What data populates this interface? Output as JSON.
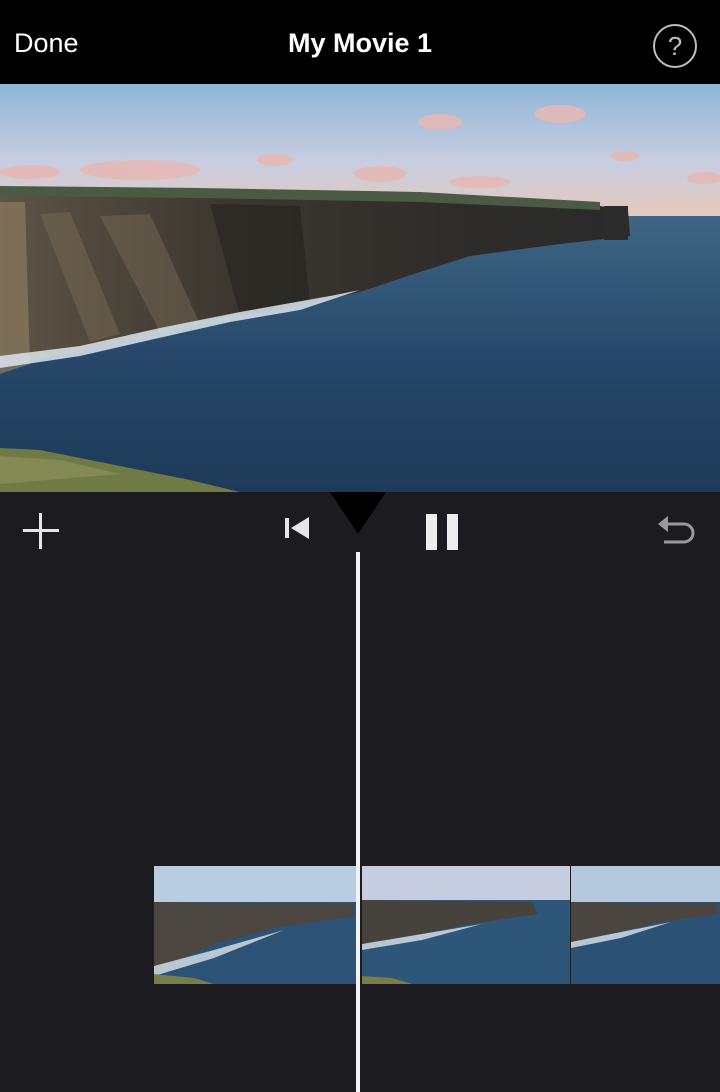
{
  "header": {
    "done_label": "Done",
    "title": "My Movie 1",
    "help_symbol": "?"
  },
  "toolbar": {
    "add_icon": "plus-icon",
    "skip_icon": "skip-to-start-icon",
    "pause_icon": "pause-icon",
    "undo_icon": "undo-icon"
  },
  "timeline": {
    "clips": [
      "cliff-coast-clip",
      "cliff-coast-clip",
      "cliff-coast-clip"
    ]
  },
  "colors": {
    "topbar": "#000000",
    "background": "#1c1b1f",
    "playhead": "#f2f2f2",
    "icons": "#e6e6e6"
  }
}
